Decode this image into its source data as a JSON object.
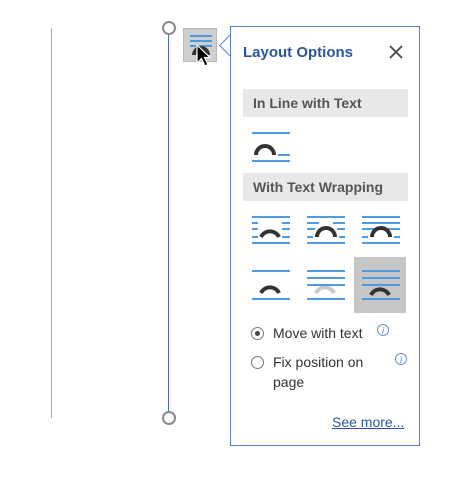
{
  "panel": {
    "title": "Layout Options",
    "close_icon": "close-icon"
  },
  "sections": {
    "inline": "In Line with Text",
    "wrapping": "With Text Wrapping"
  },
  "options": {
    "move_with_text": "Move with text",
    "fix_position": "Fix position on page",
    "selected_radio": "move_with_text"
  },
  "links": {
    "see_more": "See more..."
  },
  "colors": {
    "accent": "#2b579a",
    "line": "#4f9be0",
    "selection": "#4a6fb8",
    "margin": "#d9a441",
    "selected_option_bg": "#c6c6c6"
  }
}
